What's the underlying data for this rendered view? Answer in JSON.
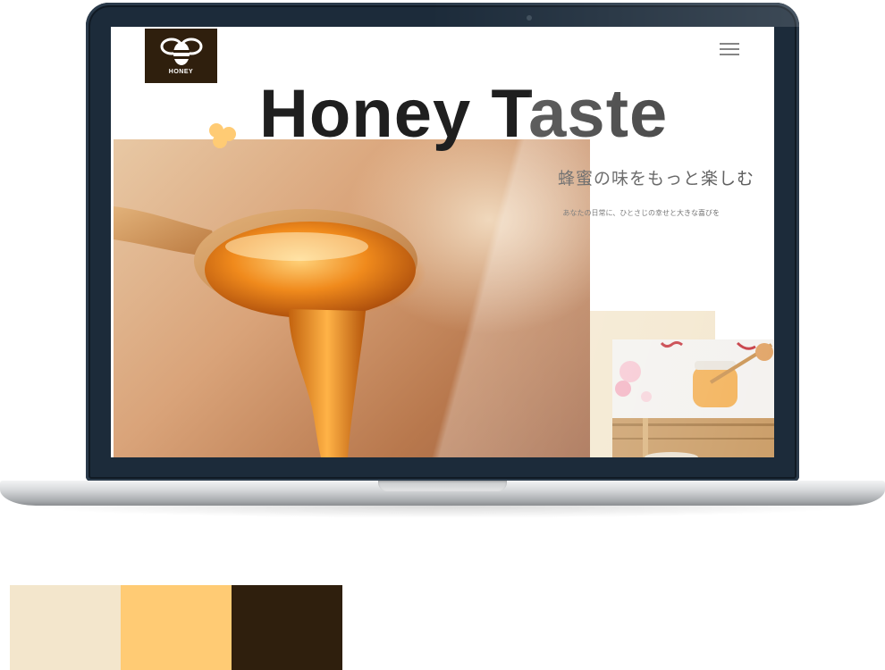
{
  "site": {
    "logo_text": "HONEY",
    "hero_title": "Honey Taste",
    "hero_subtitle": "蜂蜜の味をもっと楽しむ",
    "hero_tagline": "あなたの日常に、ひとさじの幸せと大きな喜びを"
  },
  "colors": {
    "accent": "#ffcb74",
    "logo_bg": "#2f1f0d",
    "title_text": "#1f1f1f",
    "bezel": "#1c2b3a"
  },
  "icons": {
    "logo": "bee-icon",
    "menu": "hamburger-menu-icon",
    "decoration": "honeycomb-dots-icon"
  },
  "palette": [
    {
      "name": "cream",
      "hex": "#f3e6cc"
    },
    {
      "name": "honey-yellow",
      "hex": "#ffcb74"
    },
    {
      "name": "dark-brown",
      "hex": "#2f1f0d"
    }
  ]
}
